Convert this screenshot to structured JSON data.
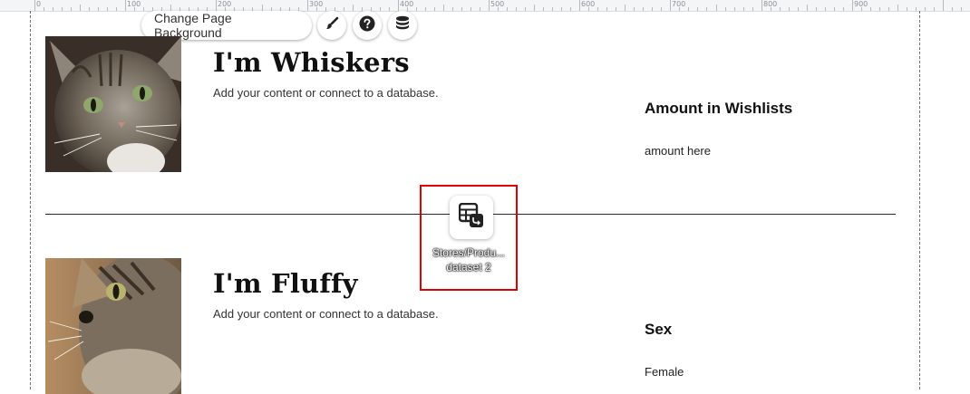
{
  "ruler": {
    "labels": [
      "0",
      "100",
      "200",
      "300",
      "400",
      "500",
      "600",
      "700",
      "800",
      "900"
    ]
  },
  "toolbar": {
    "change_bg_label": "Change Page Background",
    "design_icon": "brush-icon",
    "help_icon": "help-icon",
    "data_icon": "database-icon"
  },
  "items": [
    {
      "title": "I'm Whiskers",
      "subtitle": "Add your content or connect to a database.",
      "right_heading": "Amount in Wishlists",
      "right_value": "amount here"
    },
    {
      "title": "I'm Fluffy",
      "subtitle": "Add your content or connect to a database.",
      "right_heading": "Sex",
      "right_value": "Female"
    }
  ],
  "dataset": {
    "line1": "Stores/Produ...",
    "line2": "dataset 2",
    "highlight_color": "#e00000"
  }
}
